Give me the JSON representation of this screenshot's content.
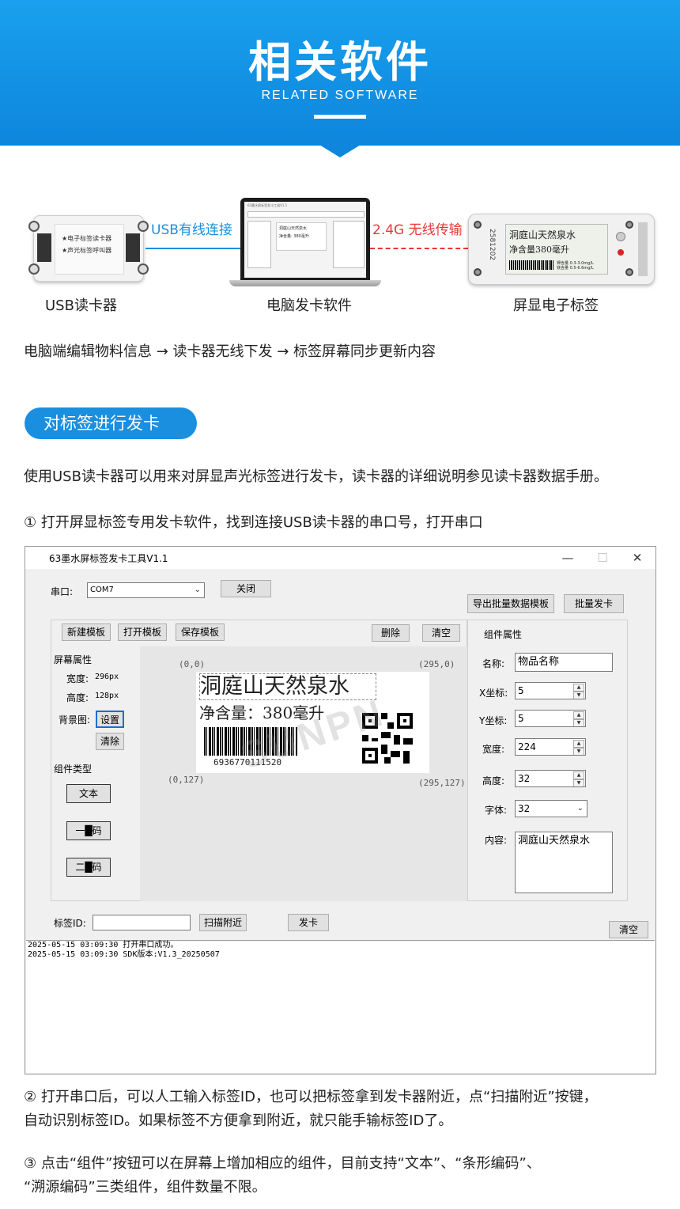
{
  "banner": {
    "title": "相关软件",
    "subtitle": "RELATED SOFTWARE"
  },
  "hardware": {
    "reader_panel_lines": [
      "★电子标签读卡器",
      "★声光标签呼叫器"
    ],
    "link_usb_label": "USB有线连接",
    "link_rf_label": "2.4G 无线传输",
    "captions": [
      "USB读卡器",
      "电脑发卡软件",
      "屏显电子标签"
    ],
    "tag_screen": {
      "line1": "洞庭山天然泉水",
      "line2": "净含量380毫升",
      "mini_lines": [
        "钾含量 0.3-3.0mg/L",
        "镁含量 0.5-6.6mg/L"
      ],
      "serial": "2581202"
    },
    "laptop_card_lines": [
      "洞庭山天然泉水",
      "净含量: 380毫升"
    ]
  },
  "flow_text": "电脑端编辑物料信息 → 读卡器无线下发 → 标签屏幕同步更新内容",
  "section_pill": "对标签进行发卡",
  "paragraphs": {
    "p1": "使用USB读卡器可以用来对屏显声光标签进行发卡，读卡器的详细说明参见读卡器数据手册。",
    "p2": "① 打开屏显标签专用发卡软件，找到连接USB读卡器的串口号，打开串口",
    "p3a": "② 打开串口后，可以人工输入标签ID，也可以把标签拿到发卡器附近，点“扫描附近”按键，",
    "p3b": "自动识别标签ID。如果标签不方便拿到附近，就只能手输标签ID了。",
    "p4a": "③ 点击“组件”按钮可以在屏幕上增加相应的组件，目前支持“文本”、“条形编码”、",
    "p4b": "“溯源编码”三类组件，组件数量不限。"
  },
  "app": {
    "title": "63墨水屏标签发卡工具V1.1",
    "window_controls": [
      "—",
      "☐",
      "✕"
    ],
    "serial_label": "串口:",
    "serial_value": "COM7",
    "close_btn": "关闭",
    "export_btn": "导出批量数据模板",
    "batch_btn": "批量发卡",
    "toolbar": {
      "new_template": "新建模板",
      "open_template": "打开模板",
      "save_template": "保存模板",
      "delete": "删除",
      "clear": "清空"
    },
    "screen_props": {
      "heading": "屏幕属性",
      "width_label": "宽度:",
      "width_value": "296px",
      "height_label": "高度:",
      "height_value": "128px",
      "bg_label": "背景图:",
      "set_btn": "设置",
      "clear_btn": "清除"
    },
    "component_types": {
      "heading": "组件类型",
      "text_btn": "文本",
      "barcode_btn": "一█码",
      "qrcode_btn": "二█码"
    },
    "canvas": {
      "coord_tl": "(0,0)",
      "coord_tr": "(295,0)",
      "coord_bl": "(0,127)",
      "coord_br": "(295,127)",
      "line1": "洞庭山天然泉水",
      "line2": "净含量：380毫升",
      "barcode_number": "6936770111520",
      "watermark": "SUNPN"
    },
    "component_props": {
      "heading": "组件属性",
      "name_label": "名称:",
      "name_value": "物品名称",
      "x_label": "X坐标:",
      "x_value": "5",
      "y_label": "Y坐标:",
      "y_value": "5",
      "width_label": "宽度:",
      "width_value": "224",
      "height_label": "高度:",
      "height_value": "32",
      "font_label": "字体:",
      "font_value": "32",
      "content_label": "内容:",
      "content_value": "洞庭山天然泉水"
    },
    "tag_id_label": "标签ID:",
    "tag_id_value": "",
    "scan_btn": "扫描附近",
    "issue_btn": "发卡",
    "clear_log_btn": "清空",
    "log_lines": [
      "2025-05-15 03:09:30 打开串口成功。",
      "2025-05-15 03:09:30 SDK版本:V1.3_20250507"
    ]
  }
}
